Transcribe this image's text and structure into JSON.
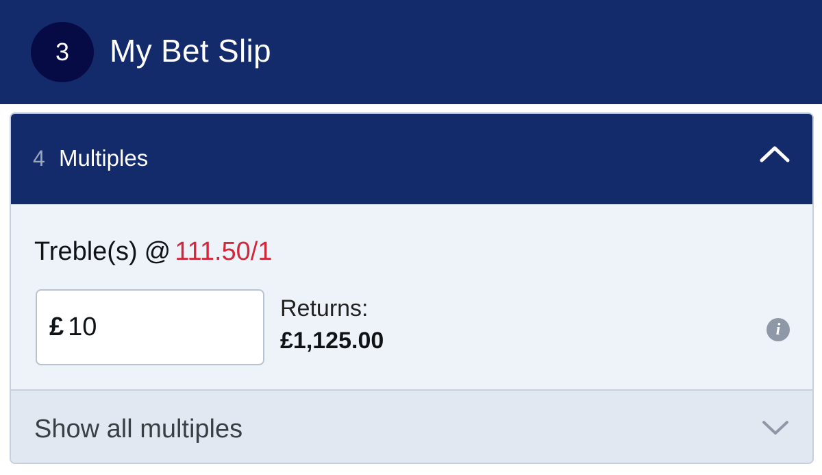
{
  "header": {
    "badge_count": "3",
    "title": "My Bet Slip"
  },
  "multiples": {
    "count": "4",
    "title": "Multiples",
    "bet_type": "Treble(s)",
    "at": "@",
    "odds": "111.50/1",
    "stake_currency": "£",
    "stake_value": "10",
    "returns_label": "Returns:",
    "returns_value": "£1,125.00",
    "info_icon": "i",
    "show_all_label": "Show all multiples"
  },
  "colors": {
    "header_bg": "#142b6b",
    "badge_bg": "#060a45",
    "odds": "#d0273b",
    "panel_bg": "#eef3fa",
    "show_all_bg": "#e1e8f2"
  },
  "icons": {
    "collapse": "chevron-up-icon",
    "expand": "chevron-down-icon",
    "info": "info-icon"
  }
}
